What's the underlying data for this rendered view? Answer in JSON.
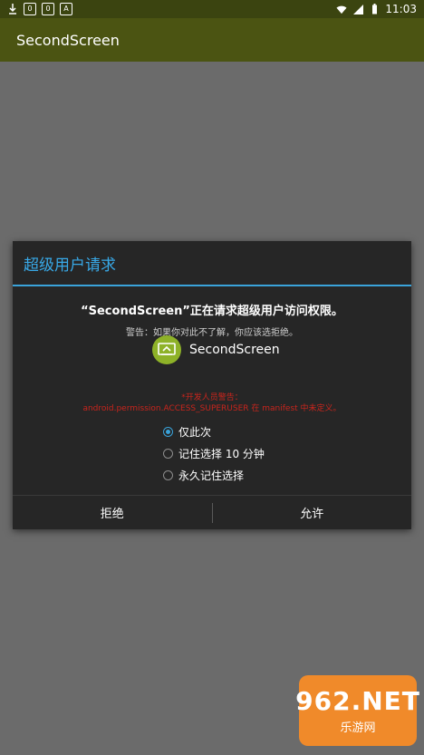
{
  "status_bar": {
    "left_badges": [
      "0",
      "0",
      "A"
    ],
    "time": "11:03"
  },
  "app_bar": {
    "title": "SecondScreen"
  },
  "dialog": {
    "title": "超级用户请求",
    "message": "“SecondScreen”正在请求超级用户访问权限。",
    "warning": "警告：如果你对此不了解，你应该选拒绝。",
    "app": {
      "name": "SecondScreen",
      "icon": "cast-screen-icon"
    },
    "dev_warning_line1": "*开发人员警告：",
    "dev_warning_line2": "android.permission.ACCESS_SUPERUSER 在 manifest 中未定义。",
    "options": [
      {
        "label": "仅此次",
        "checked": true
      },
      {
        "label": "记住选择 10 分钟",
        "checked": false
      },
      {
        "label": "永久记住选择",
        "checked": false
      }
    ],
    "deny_label": "拒绝",
    "allow_label": "允许"
  },
  "watermark": {
    "top": "962.NET",
    "bottom": "乐游网"
  },
  "colors": {
    "app_bar": "#4b5412",
    "dialog_title": "#38a9e8",
    "warning_red": "#c8251d",
    "app_icon": "#8eb228"
  }
}
